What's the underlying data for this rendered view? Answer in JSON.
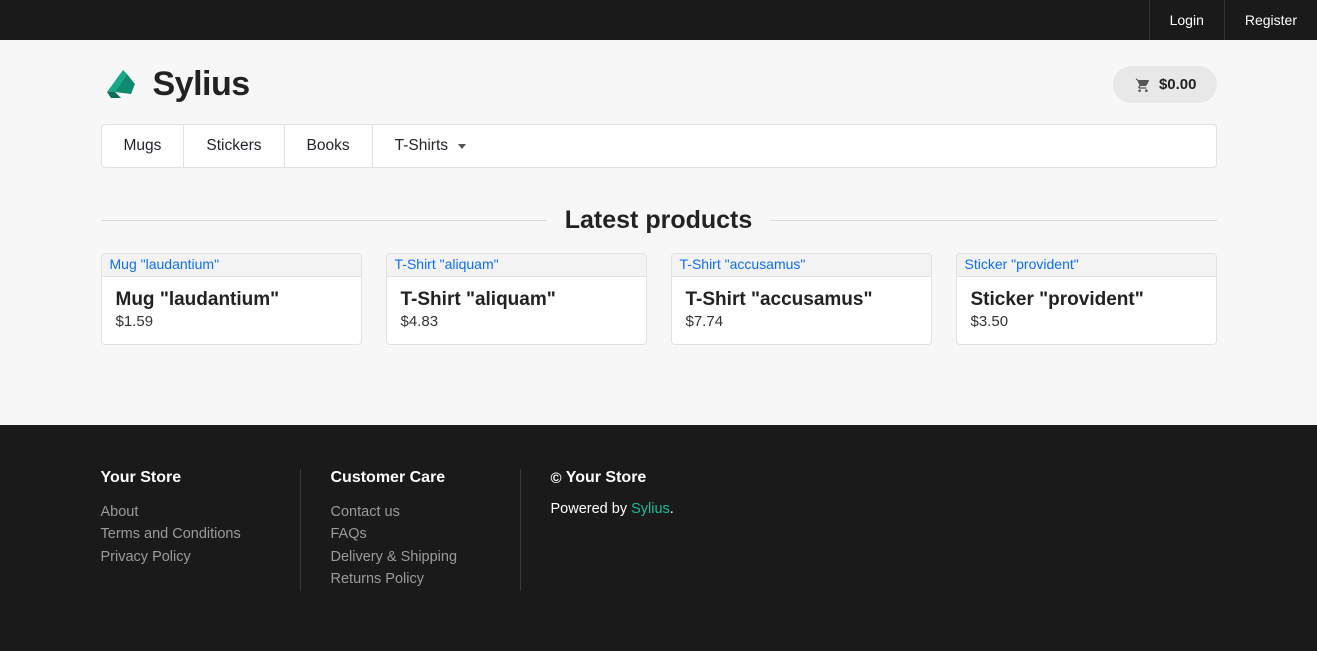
{
  "topbar": {
    "login": "Login",
    "register": "Register"
  },
  "brand": {
    "name": "Sylius"
  },
  "cart": {
    "amount": "$0.00"
  },
  "nav": {
    "items": [
      {
        "label": "Mugs",
        "dropdown": false
      },
      {
        "label": "Stickers",
        "dropdown": false
      },
      {
        "label": "Books",
        "dropdown": false
      },
      {
        "label": "T-Shirts",
        "dropdown": true
      }
    ]
  },
  "section": {
    "latest_title": "Latest products"
  },
  "products": [
    {
      "link": "Mug \"laudantium\"",
      "title": "Mug \"laudantium\"",
      "price": "$1.59"
    },
    {
      "link": "T-Shirt \"aliquam\"",
      "title": "T-Shirt \"aliquam\"",
      "price": "$4.83"
    },
    {
      "link": "T-Shirt \"accusamus\"",
      "title": "T-Shirt \"accusamus\"",
      "price": "$7.74"
    },
    {
      "link": "Sticker \"provident\"",
      "title": "Sticker \"provident\"",
      "price": "$3.50"
    }
  ],
  "footer": {
    "col1_title": "Your Store",
    "col1_links": [
      "About",
      "Terms and Conditions",
      "Privacy Policy"
    ],
    "col2_title": "Customer Care",
    "col2_links": [
      "Contact us",
      "FAQs",
      "Delivery & Shipping",
      "Returns Policy"
    ],
    "copyright": "Your Store",
    "powered_prefix": "Powered by ",
    "powered_link": "Sylius",
    "powered_suffix": "."
  }
}
